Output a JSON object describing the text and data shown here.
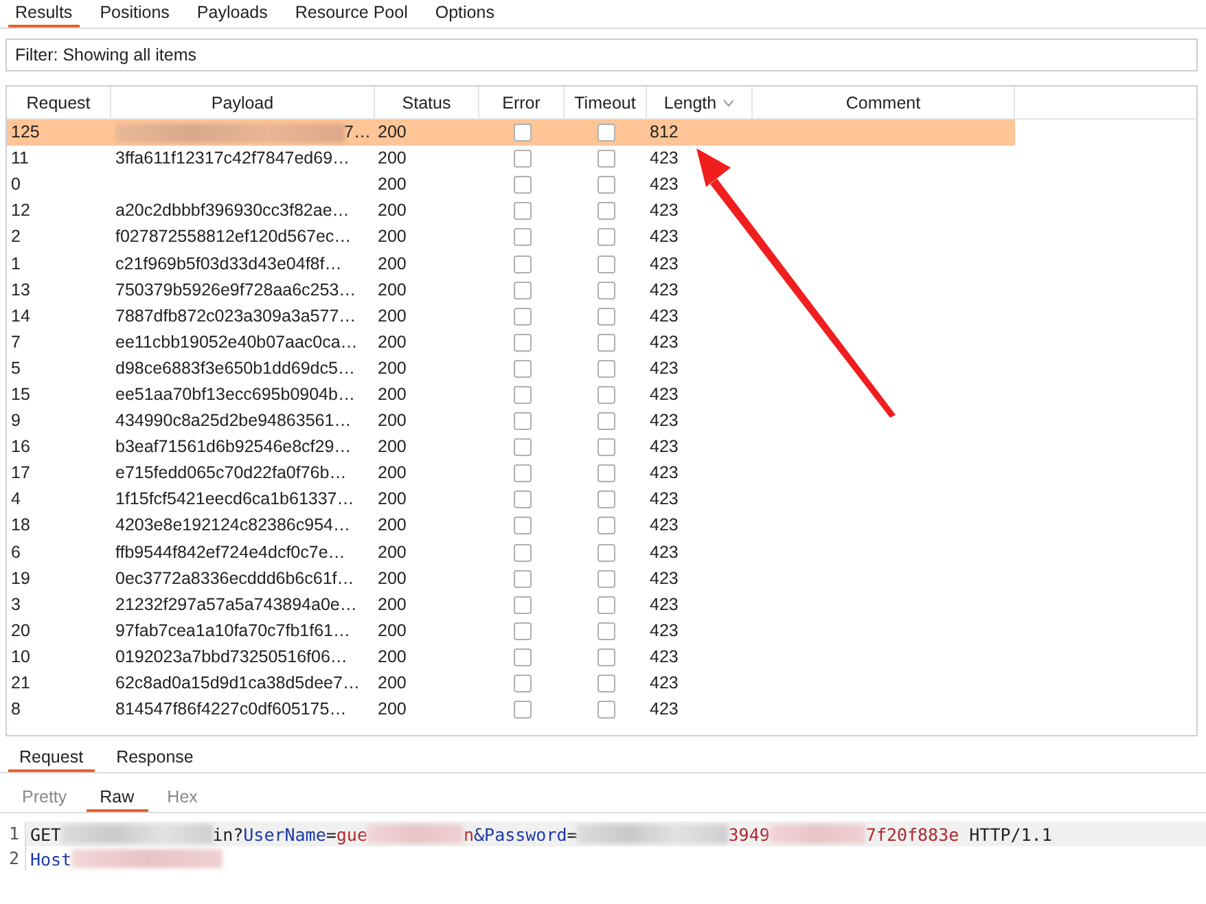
{
  "tabs": [
    {
      "label": "Results",
      "selected": true
    },
    {
      "label": "Positions",
      "selected": false
    },
    {
      "label": "Payloads",
      "selected": false
    },
    {
      "label": "Resource Pool",
      "selected": false
    },
    {
      "label": "Options",
      "selected": false
    }
  ],
  "filter": "Filter: Showing all items",
  "table": {
    "columns": [
      {
        "label": "Request",
        "sorted": false
      },
      {
        "label": "Payload",
        "sorted": false
      },
      {
        "label": "Status",
        "sorted": false
      },
      {
        "label": "Error",
        "sorted": false
      },
      {
        "label": "Timeout",
        "sorted": false
      },
      {
        "label": "Length",
        "sorted": true
      },
      {
        "label": "Comment",
        "sorted": false
      }
    ],
    "rows": [
      {
        "request": "125",
        "payload": "7…",
        "payload_redacted": true,
        "status": "200",
        "error": false,
        "timeout": false,
        "length": "812",
        "selected": true
      },
      {
        "request": "11",
        "payload": "3ffa611f12317c42f7847ed69…",
        "status": "200",
        "error": false,
        "timeout": false,
        "length": "423",
        "selected": false
      },
      {
        "request": "0",
        "status": "200",
        "error": false,
        "timeout": false,
        "length": "423",
        "selected": false
      },
      {
        "request": "12",
        "payload": "a20c2dbbbf396930cc3f82ae…",
        "status": "200",
        "error": false,
        "timeout": false,
        "length": "423",
        "selected": false
      },
      {
        "request": "2",
        "payload": "f027872558812ef120d567ec…",
        "status": "200",
        "error": false,
        "timeout": false,
        "length": "423",
        "selected": false
      },
      {
        "request": "1",
        "payload": "c21f969b5f03d33d43e04f8f…",
        "status": "200",
        "error": false,
        "timeout": false,
        "length": "423",
        "selected": false
      },
      {
        "request": "13",
        "payload": "750379b5926e9f728aa6c253…",
        "status": "200",
        "error": false,
        "timeout": false,
        "length": "423",
        "selected": false
      },
      {
        "request": "14",
        "payload": "7887dfb872c023a309a3a577…",
        "status": "200",
        "error": false,
        "timeout": false,
        "length": "423",
        "selected": false
      },
      {
        "request": "7",
        "payload": "ee11cbb19052e40b07aac0ca…",
        "status": "200",
        "error": false,
        "timeout": false,
        "length": "423",
        "selected": false
      },
      {
        "request": "5",
        "payload": "d98ce6883f3e650b1dd69dc5…",
        "status": "200",
        "error": false,
        "timeout": false,
        "length": "423",
        "selected": false
      },
      {
        "request": "15",
        "payload": "ee51aa70bf13ecc695b0904b…",
        "status": "200",
        "error": false,
        "timeout": false,
        "length": "423",
        "selected": false
      },
      {
        "request": "9",
        "payload": "434990c8a25d2be94863561…",
        "status": "200",
        "error": false,
        "timeout": false,
        "length": "423",
        "selected": false
      },
      {
        "request": "16",
        "payload": "b3eaf71561d6b92546e8cf29…",
        "status": "200",
        "error": false,
        "timeout": false,
        "length": "423",
        "selected": false
      },
      {
        "request": "17",
        "payload": "e715fedd065c70d22fa0f76b…",
        "status": "200",
        "error": false,
        "timeout": false,
        "length": "423",
        "selected": false
      },
      {
        "request": "4",
        "payload": "1f15fcf5421eecd6ca1b61337…",
        "status": "200",
        "error": false,
        "timeout": false,
        "length": "423",
        "selected": false
      },
      {
        "request": "18",
        "payload": "4203e8e192124c82386c954…",
        "status": "200",
        "error": false,
        "timeout": false,
        "length": "423",
        "selected": false
      },
      {
        "request": "6",
        "payload": "ffb9544f842ef724e4dcf0c7e…",
        "status": "200",
        "error": false,
        "timeout": false,
        "length": "423",
        "selected": false
      },
      {
        "request": "19",
        "payload": "0ec3772a8336ecddd6b6c61f…",
        "status": "200",
        "error": false,
        "timeout": false,
        "length": "423",
        "selected": false
      },
      {
        "request": "3",
        "payload": "21232f297a57a5a743894a0e…",
        "status": "200",
        "error": false,
        "timeout": false,
        "length": "423",
        "selected": false
      },
      {
        "request": "20",
        "payload": "97fab7cea1a10fa70c7fb1f61…",
        "status": "200",
        "error": false,
        "timeout": false,
        "length": "423",
        "selected": false
      },
      {
        "request": "10",
        "payload": "0192023a7bbd73250516f06…",
        "status": "200",
        "error": false,
        "timeout": false,
        "length": "423",
        "selected": false
      },
      {
        "request": "21",
        "payload": "62c8ad0a15d9d1ca38d5dee7…",
        "status": "200",
        "error": false,
        "timeout": false,
        "length": "423",
        "selected": false
      },
      {
        "request": "8",
        "payload": "814547f86f4227c0df605175…",
        "status": "200",
        "error": false,
        "timeout": false,
        "length": "423",
        "selected": false
      }
    ]
  },
  "message_tabs": [
    {
      "label": "Request",
      "selected": true
    },
    {
      "label": "Response",
      "selected": false
    }
  ],
  "view_tabs": [
    {
      "label": "Pretty",
      "selected": false
    },
    {
      "label": "Raw",
      "selected": true
    },
    {
      "label": "Hex",
      "selected": false
    }
  ],
  "editor_lines": [
    {
      "number": "1",
      "tokens": [
        {
          "kind": "plain",
          "text": "GET"
        },
        {
          "kind": "redacted"
        },
        {
          "kind": "plain",
          "text": "in?"
        },
        {
          "kind": "key",
          "text": "UserName"
        },
        {
          "kind": "plain",
          "text": "="
        },
        {
          "kind": "value",
          "text": "gue"
        },
        {
          "kind": "redacted"
        },
        {
          "kind": "value",
          "text": "n"
        },
        {
          "kind": "key",
          "text": "&Password"
        },
        {
          "kind": "plain",
          "text": "="
        },
        {
          "kind": "redacted"
        },
        {
          "kind": "value",
          "text": "3949"
        },
        {
          "kind": "redacted"
        },
        {
          "kind": "value",
          "text": "7f20f883e"
        },
        {
          "kind": "plain",
          "text": " HTTP/1.1"
        }
      ]
    },
    {
      "number": "2",
      "tokens": [
        {
          "kind": "key",
          "text": "Host"
        },
        {
          "kind": "redacted"
        }
      ]
    }
  ],
  "annotation": {
    "kind": "arrow"
  }
}
